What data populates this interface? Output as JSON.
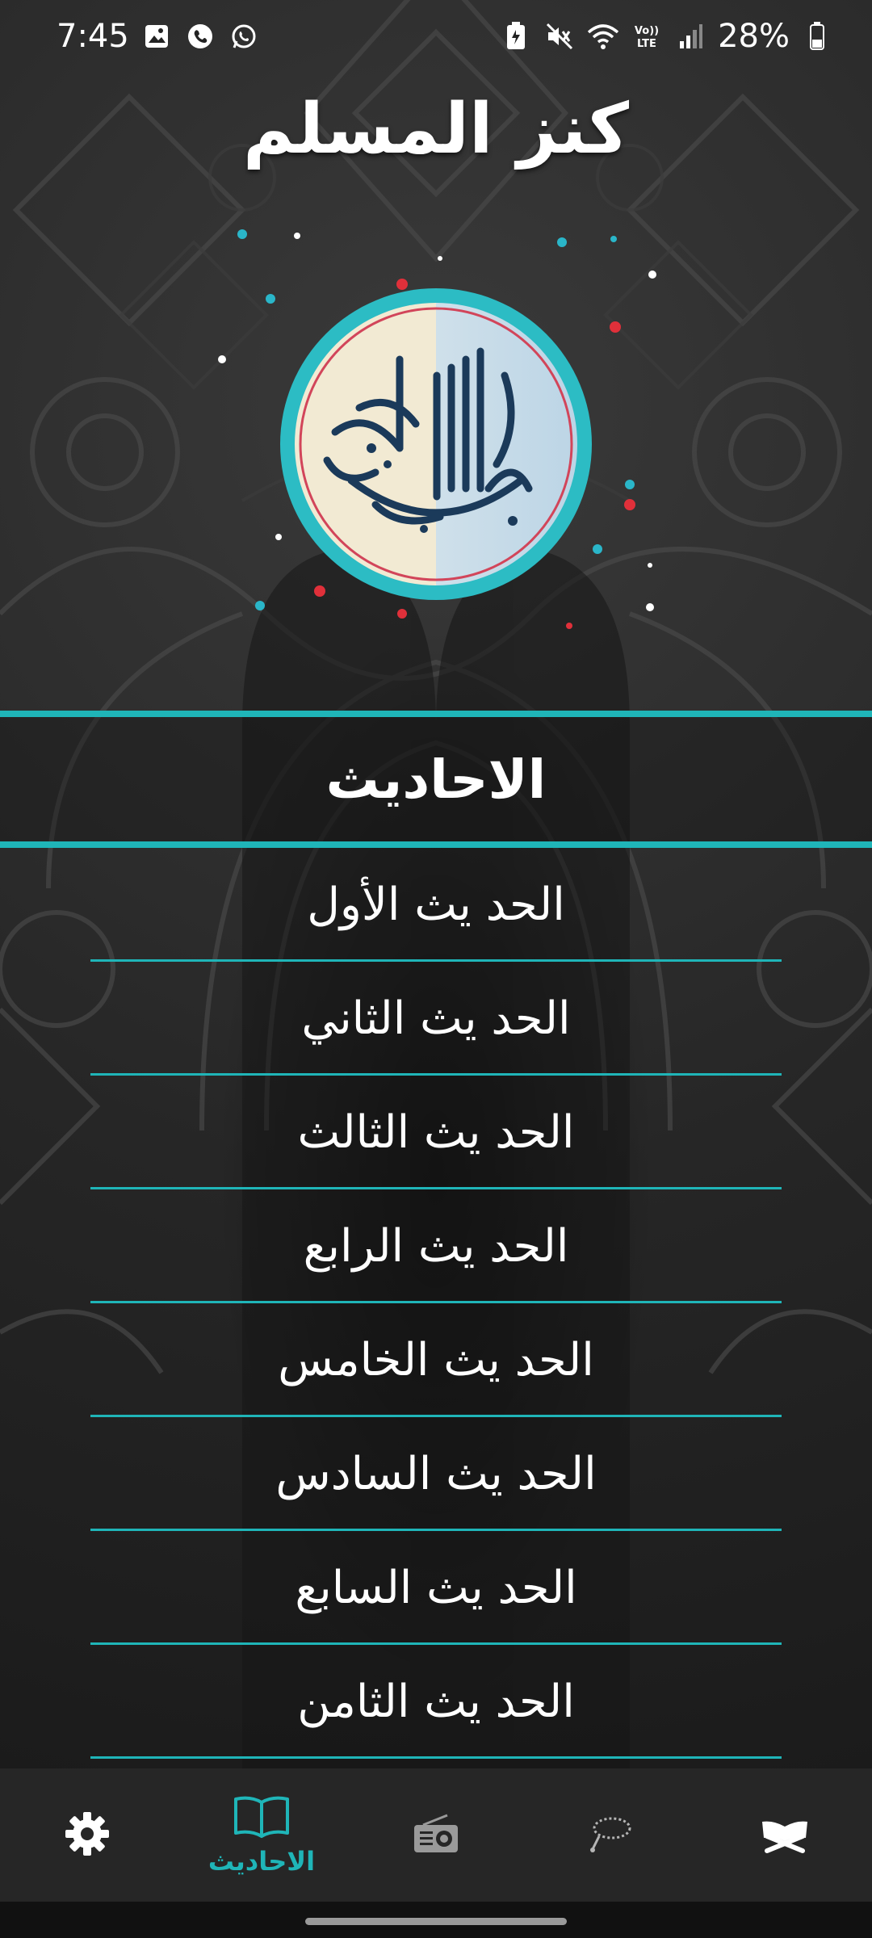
{
  "status_bar": {
    "time": "7:45",
    "battery": "28%",
    "left_icons": [
      "gallery-icon",
      "viber-icon",
      "whatsapp-icon"
    ],
    "right_icons": [
      "battery-saver-icon",
      "mute-icon",
      "wifi-icon",
      "volte-icon",
      "signal-icon",
      "battery-icon"
    ]
  },
  "header": {
    "title": "كنز المسلم"
  },
  "section": {
    "title": "الاحاديث"
  },
  "hadith_list": [
    {
      "label": "الحد يث الأول"
    },
    {
      "label": "الحد يث الثاني"
    },
    {
      "label": "الحد يث الثالث"
    },
    {
      "label": "الحد يث الرابع"
    },
    {
      "label": "الحد يث الخامس"
    },
    {
      "label": "الحد يث السادس"
    },
    {
      "label": "الحد يث السابع"
    },
    {
      "label": "الحد يث الثامن"
    }
  ],
  "bottom_nav": {
    "items": [
      {
        "icon": "gear-icon",
        "label": ""
      },
      {
        "icon": "book-icon",
        "label": "الاحاديث",
        "active": true
      },
      {
        "icon": "radio-icon",
        "label": ""
      },
      {
        "icon": "prayer-beads-icon",
        "label": ""
      },
      {
        "icon": "quran-icon",
        "label": ""
      }
    ]
  },
  "colors": {
    "accent": "#1fb5b8",
    "background": "#1e1e1e",
    "nav_background": "#262626",
    "text": "#ffffff"
  }
}
